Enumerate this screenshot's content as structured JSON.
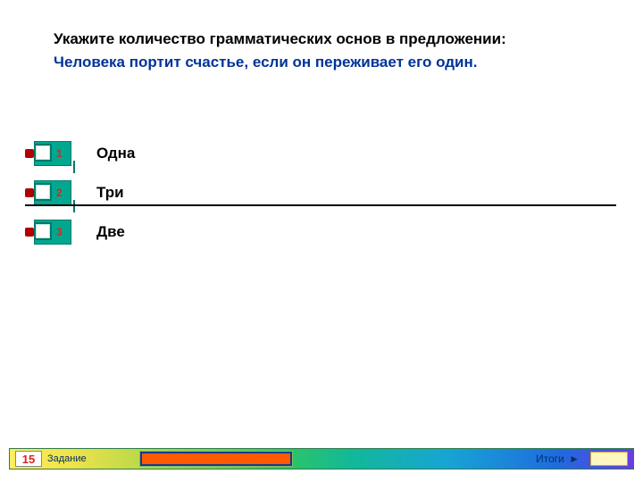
{
  "question": {
    "prompt": "Укажите количество грамматических основ в предложении:",
    "sentence": "Человека портит счастье, если он переживает его один."
  },
  "answers": [
    {
      "n": "1",
      "label": "Одна"
    },
    {
      "n": "2",
      "label": "Три"
    },
    {
      "n": "3",
      "label": "Две"
    }
  ],
  "footer": {
    "task_number": "15",
    "task_label": "Задание",
    "totals_label": "Итоги",
    "totals_arrow": "►",
    "totals_value": ""
  }
}
